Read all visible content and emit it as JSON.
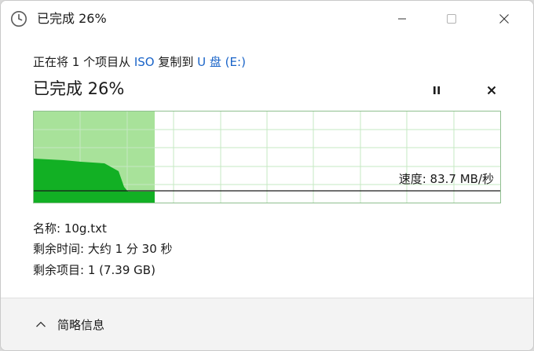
{
  "window": {
    "title": "已完成 26%",
    "icon": "clock-icon"
  },
  "copy": {
    "prefix": "正在将 1 个项目从 ",
    "source": "ISO",
    "middle": " 复制到 ",
    "destination": "U 盘 (E:)"
  },
  "progress": {
    "title": "已完成 26%",
    "percent": 26,
    "speed_label": "速度: 83.7 MB/秒"
  },
  "controls": {
    "pause_icon": "pause-icon",
    "cancel_icon": "close-icon"
  },
  "info": {
    "name": "名称: 10g.txt",
    "time_remaining": "剩余时间: 大约 1 分 30 秒",
    "items_remaining": "剩余项目: 1 (7.39 GB)"
  },
  "footer": {
    "details_label": "简略信息",
    "details_icon": "chevron-up-icon"
  },
  "colors": {
    "accent_link": "#1a64c8",
    "progress_fill": "#a8e29a",
    "speed_fill": "#12b024",
    "grid": "#c6e8c3"
  }
}
